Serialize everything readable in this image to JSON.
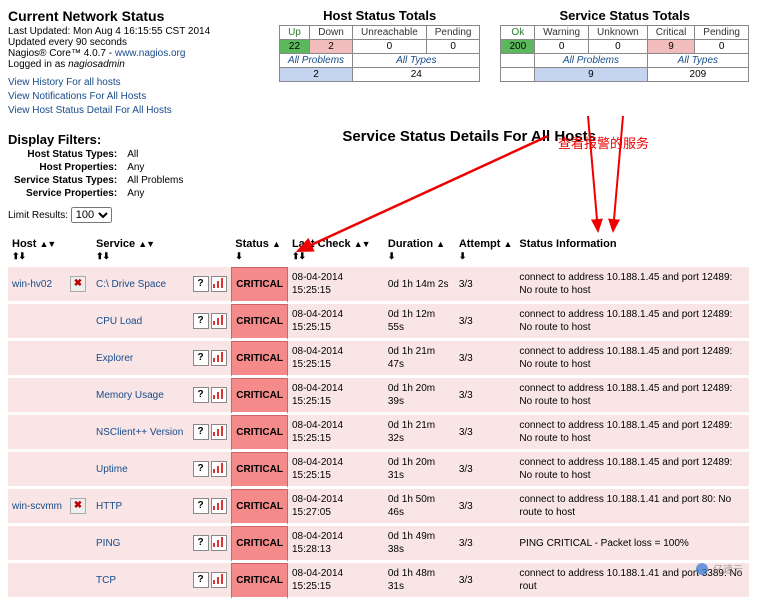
{
  "header": {
    "title": "Current Network Status",
    "last_updated": "Last Updated: Mon Aug 4 16:15:55 CST 2014",
    "refresh": "Updated every 90 seconds",
    "product_prefix": "Nagios® Core™ 4.0.7 - ",
    "site_url": "www.nagios.org",
    "logged_prefix": "Logged in as ",
    "logged_user": "nagiosadmin"
  },
  "links": {
    "history": "View History For all hosts",
    "notifications": "View Notifications For All Hosts",
    "host_detail": "View Host Status Detail For All Hosts"
  },
  "host_totals": {
    "title": "Host Status Totals",
    "cols": {
      "up": "Up",
      "down": "Down",
      "unreach": "Unreachable",
      "pending": "Pending"
    },
    "vals": {
      "up": "22",
      "down": "2",
      "unreach": "0",
      "pending": "0"
    },
    "sub_labels": {
      "problems": "All Problems",
      "types": "All Types"
    },
    "sub_vals": {
      "problems": "2",
      "types": "24"
    }
  },
  "svc_totals": {
    "title": "Service Status Totals",
    "cols": {
      "ok": "Ok",
      "warn": "Warning",
      "unk": "Unknown",
      "crit": "Critical",
      "pend": "Pending"
    },
    "vals": {
      "ok": "200",
      "warn": "0",
      "unk": "0",
      "crit": "9",
      "pend": "0"
    },
    "sub_labels": {
      "problems": "All Problems",
      "types": "All Types"
    },
    "sub_vals": {
      "problems": "9",
      "types": "209"
    }
  },
  "filters": {
    "title": "Display Filters:",
    "labels": {
      "hst": "Host Status Types:",
      "hprop": "Host Properties:",
      "sst": "Service Status Types:",
      "sprop": "Service Properties:"
    },
    "values": {
      "hst": "All",
      "hprop": "Any",
      "sst": "All Problems",
      "sprop": "Any"
    }
  },
  "page_title": "Service Status Details For All Hosts",
  "annotation_cn": "查看报警的服务",
  "limit": {
    "label": "Limit Results:",
    "value": "100"
  },
  "columns": {
    "host": "Host",
    "service": "Service",
    "status": "Status",
    "last_check": "Last Check",
    "duration": "Duration",
    "attempt": "Attempt",
    "info": "Status Information"
  },
  "rows": [
    {
      "host": "win-hv02",
      "service": "C:\\ Drive Space",
      "status": "CRITICAL",
      "last_check": "08-04-2014 15:25:15",
      "duration": "0d 1h 14m 2s",
      "attempt": "3/3",
      "info": "connect to address 10.188.1.45 and port 12489: No route to host"
    },
    {
      "host": "",
      "service": "CPU Load",
      "status": "CRITICAL",
      "last_check": "08-04-2014 15:25:15",
      "duration": "0d 1h 12m 55s",
      "attempt": "3/3",
      "info": "connect to address 10.188.1.45 and port 12489: No route to host"
    },
    {
      "host": "",
      "service": "Explorer",
      "status": "CRITICAL",
      "last_check": "08-04-2014 15:25:15",
      "duration": "0d 1h 21m 47s",
      "attempt": "3/3",
      "info": "connect to address 10.188.1.45 and port 12489: No route to host"
    },
    {
      "host": "",
      "service": "Memory Usage",
      "status": "CRITICAL",
      "last_check": "08-04-2014 15:25:15",
      "duration": "0d 1h 20m 39s",
      "attempt": "3/3",
      "info": "connect to address 10.188.1.45 and port 12489: No route to host"
    },
    {
      "host": "",
      "service": "NSClient++ Version",
      "status": "CRITICAL",
      "last_check": "08-04-2014 15:25:15",
      "duration": "0d 1h 21m 32s",
      "attempt": "3/3",
      "info": "connect to address 10.188.1.45 and port 12489: No route to host"
    },
    {
      "host": "",
      "service": "Uptime",
      "status": "CRITICAL",
      "last_check": "08-04-2014 15:25:15",
      "duration": "0d 1h 20m 31s",
      "attempt": "3/3",
      "info": "connect to address 10.188.1.45 and port 12489: No route to host"
    },
    {
      "host": "win-scvmm",
      "service": "HTTP",
      "status": "CRITICAL",
      "last_check": "08-04-2014 15:27:05",
      "duration": "0d 1h 50m 46s",
      "attempt": "3/3",
      "info": "connect to address 10.188.1.41 and port 80: No route to host"
    },
    {
      "host": "",
      "service": "PING",
      "status": "CRITICAL",
      "last_check": "08-04-2014 15:28:13",
      "duration": "0d 1h 49m 38s",
      "attempt": "3/3",
      "info": "PING CRITICAL - Packet loss = 100%"
    },
    {
      "host": "",
      "service": "TCP",
      "status": "CRITICAL",
      "last_check": "08-04-2014 15:25:15",
      "duration": "0d 1h 48m 31s",
      "attempt": "3/3",
      "info": "connect to address 10.188.1.41 and port 3389: No rout"
    }
  ],
  "watermark": "亿速云"
}
